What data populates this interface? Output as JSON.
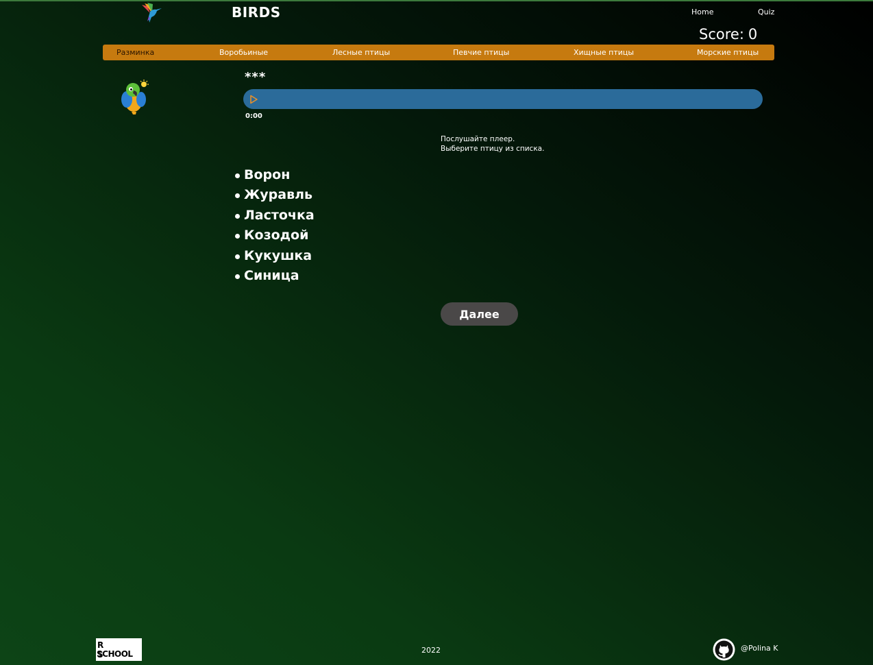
{
  "header": {
    "brand": "BIRDS",
    "logo_icon": "hummingbird-logo-icon",
    "nav": [
      {
        "label": "Home"
      },
      {
        "label": "Quiz"
      }
    ],
    "score_label": "Score:",
    "score_value": "0"
  },
  "categories": [
    {
      "label": "Разминка",
      "active": true
    },
    {
      "label": "Воробьиные",
      "active": false
    },
    {
      "label": "Лесные птицы",
      "active": false
    },
    {
      "label": "Певчие птицы",
      "active": false
    },
    {
      "label": "Хищные птицы",
      "active": false
    },
    {
      "label": "Морские птицы",
      "active": false
    }
  ],
  "question": {
    "bird_image_icon": "parrot-placeholder-icon",
    "hidden_name": "***",
    "player": {
      "play_icon": "play-icon",
      "time": "0:00",
      "progress": 0
    }
  },
  "instructions": {
    "line1": "Послушайте плеер.",
    "line2": "Выберите птицу из списка."
  },
  "answers": [
    "Ворон",
    "Журавль",
    "Ласточка",
    "Козодой",
    "Кукушка",
    "Синица"
  ],
  "next_button": "Далее",
  "footer": {
    "school_logo_line1": "R S",
    "school_logo_line2": "SCHOOL",
    "year": "2022",
    "github_icon": "github-icon",
    "author": "@Polina K"
  },
  "colors": {
    "category_bar": "#c67a0f",
    "player": "#2b6b9a",
    "play_icon": "#e8902a",
    "next_button": "#4a4848"
  }
}
